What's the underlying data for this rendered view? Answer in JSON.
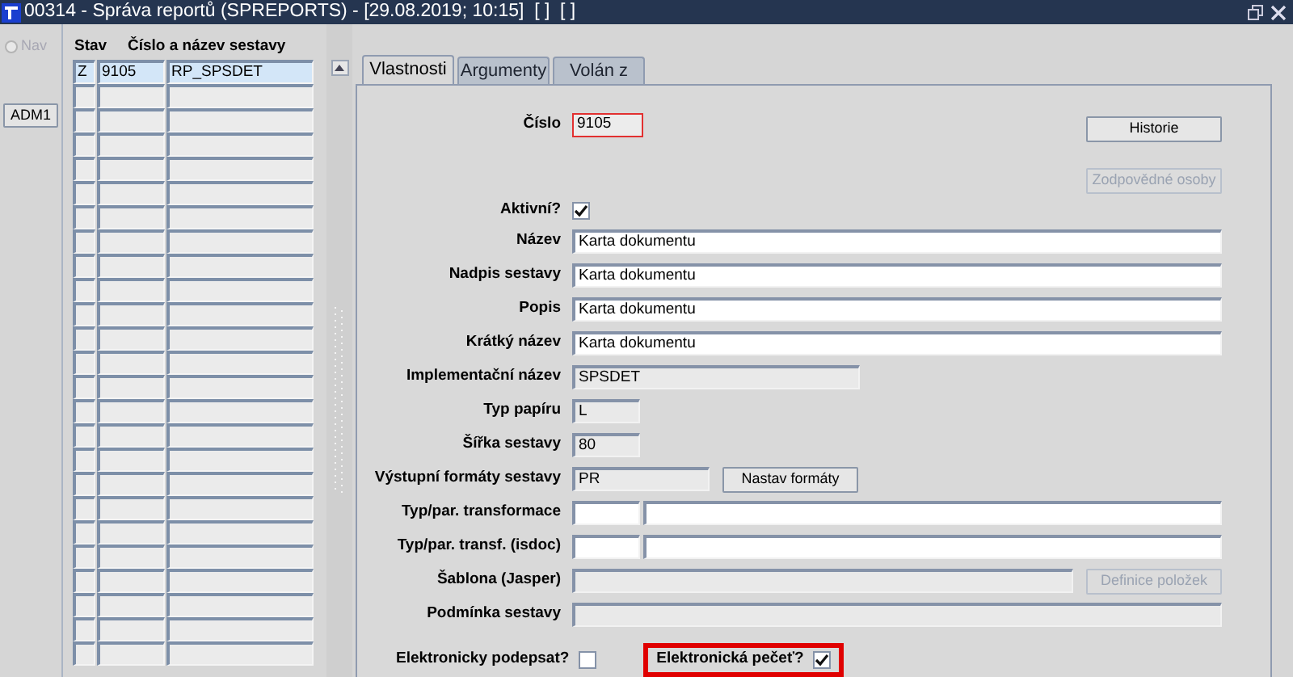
{
  "window": {
    "title": "00314 - Správa reportů (SPREPORTS) - [29.08.2019; 10:15]  [ ]  [ ]"
  },
  "nav": {
    "label": "Nav",
    "selected": false,
    "disabled": true
  },
  "user_button": {
    "label": "ADM1"
  },
  "list": {
    "columns": [
      "Stav",
      "Číslo a název sestavy"
    ],
    "rows": [
      {
        "stav": "Z",
        "cislo": "9105",
        "nazev": "RP_SPSDET",
        "selected": true
      }
    ]
  },
  "tabs": [
    {
      "label": "Vlastnosti",
      "selected": true
    },
    {
      "label": "Argumenty",
      "selected": false
    },
    {
      "label": "Volán z",
      "selected": false
    }
  ],
  "form": {
    "rows": [
      {
        "kind": "number",
        "label": "Číslo",
        "value": "9105",
        "focused": true,
        "button": {
          "label": "Historie",
          "disabled": false
        }
      },
      {
        "kind": "button_only",
        "button": {
          "label": "Zodpovědné osoby",
          "disabled": true
        }
      },
      {
        "kind": "checkbox",
        "label": "Aktivní?",
        "checked": true
      },
      {
        "kind": "wide",
        "label": "Název",
        "value": "Karta dokumentu",
        "editable": true
      },
      {
        "kind": "wide",
        "label": "Nadpis sestavy",
        "value": "Karta dokumentu",
        "editable": true
      },
      {
        "kind": "wide",
        "label": "Popis",
        "value": "Karta dokumentu",
        "editable": true
      },
      {
        "kind": "wide",
        "label": "Krátký název",
        "value": "Karta dokumentu",
        "editable": true
      },
      {
        "kind": "medium",
        "label": "Implementační název",
        "value": "SPSDET",
        "editable": false
      },
      {
        "kind": "short",
        "label": "Typ papíru",
        "value": "L",
        "editable": false
      },
      {
        "kind": "short",
        "label": "Šířka sestavy",
        "value": "80",
        "editable": false
      },
      {
        "kind": "format",
        "label": "Výstupní formáty sestavy",
        "value": "PR",
        "editable": false,
        "button": {
          "label": "Nastav formáty",
          "disabled": false
        }
      },
      {
        "kind": "pair",
        "label": "Typ/par. transformace",
        "editable": true
      },
      {
        "kind": "pair",
        "label": "Typ/par. transf. (isdoc)",
        "editable": true
      },
      {
        "kind": "template",
        "label": "Šablona (Jasper)",
        "editable": false,
        "button": {
          "label": "Definice položek",
          "disabled": true
        }
      },
      {
        "kind": "wide",
        "label": "Podmínka sestavy",
        "editable": false
      }
    ],
    "signatures": [
      {
        "label": "Elektronicky podepsat?",
        "checked": false,
        "highlighted": false
      },
      {
        "label": "Elektronická pečeť?",
        "checked": true,
        "highlighted": true
      }
    ]
  }
}
